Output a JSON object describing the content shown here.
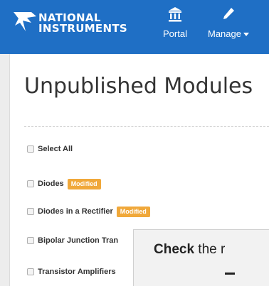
{
  "navbar": {
    "brand": {
      "line1": "NATIONAL",
      "line2": "INSTRUMENTS"
    },
    "items": [
      {
        "label": "Portal",
        "icon": "bank-icon"
      },
      {
        "label": "Manage",
        "icon": "pencil-icon",
        "dropdown": true
      }
    ],
    "color": "#1f6fc5"
  },
  "page": {
    "title": "Unpublished Modules"
  },
  "select_all": {
    "label": "Select All",
    "checked": false
  },
  "modules": [
    {
      "name": "Diodes",
      "badge": "Modified",
      "checked": false
    },
    {
      "name": "Diodes in a Rectifier",
      "badge": "Modified",
      "checked": false
    },
    {
      "name": "Bipolar Junction Tran",
      "badge": "",
      "checked": false
    },
    {
      "name": "Transistor Amplifiers",
      "badge": "",
      "checked": false
    }
  ],
  "hint": {
    "bold": "Check",
    "rest": " the r"
  },
  "colors": {
    "badge": "#f0a83a",
    "title": "#333333"
  }
}
